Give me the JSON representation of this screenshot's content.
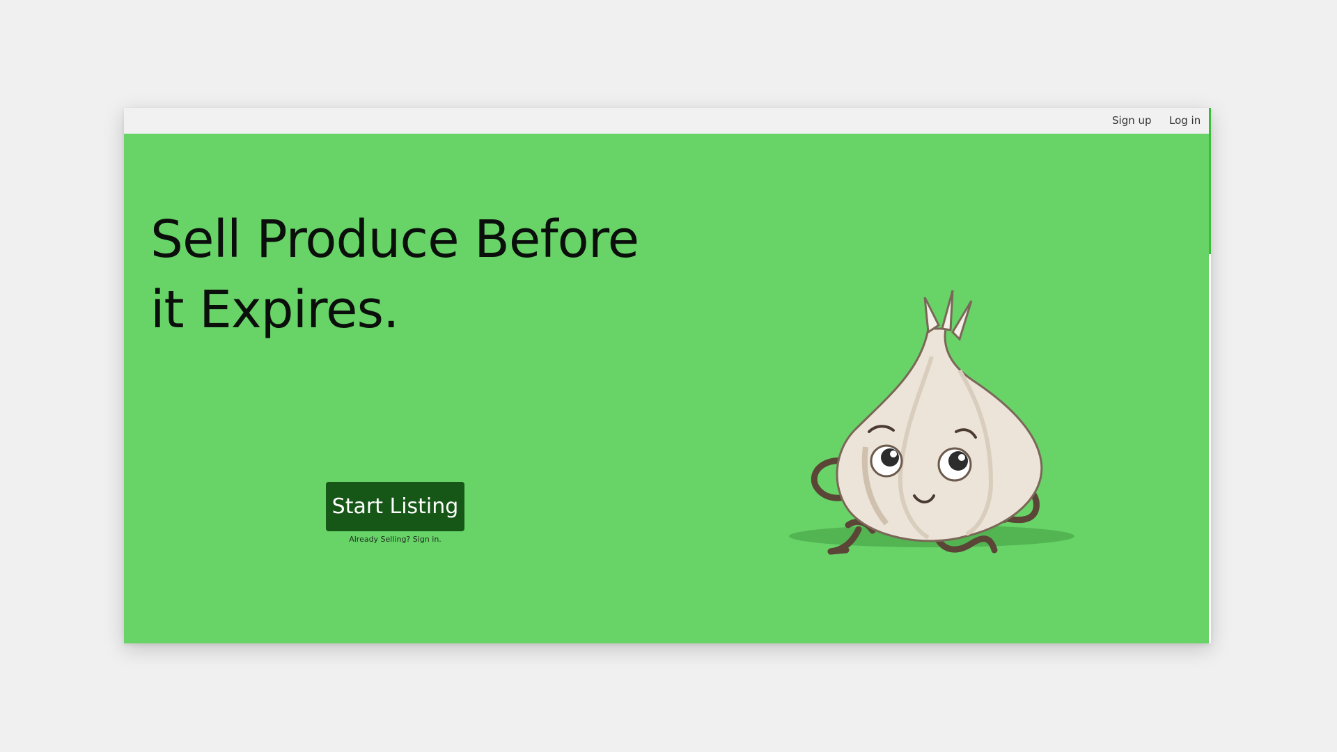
{
  "nav": {
    "signup_label": "Sign up",
    "login_label": "Log in"
  },
  "hero": {
    "headline": "Sell Produce Before it Expires.",
    "cta_label": "Start Listing",
    "signin_text": "Already Selling? Sign in.",
    "background_color": "#68d468",
    "cta_color": "#165616"
  },
  "illustration": {
    "icon": "garlic-mascot"
  }
}
